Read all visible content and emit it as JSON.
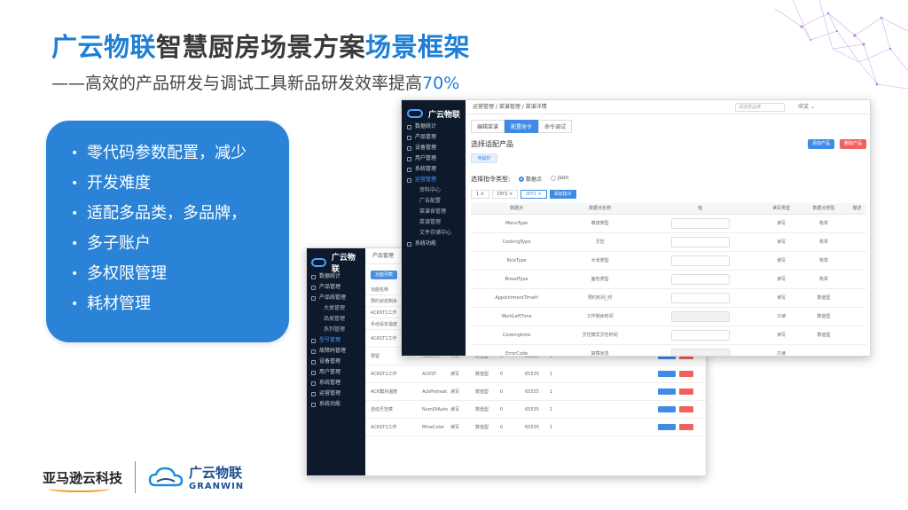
{
  "slide": {
    "title_part1": "广云物联",
    "title_part2": "智慧厨房场景方案",
    "title_part3": "场景框架",
    "subtitle_text": "——高效的产品研发与调试工具新品研发效率提高",
    "subtitle_highlight": "70%"
  },
  "features": {
    "items": [
      {
        "line1": "零代码参数配置，减少",
        "line2": "开发难度"
      },
      {
        "line1": "适配多品类，多品牌，",
        "line2": "多子账户"
      },
      {
        "line1": "多权限管理",
        "line2": ""
      },
      {
        "line1": "耗材管理",
        "line2": ""
      }
    ]
  },
  "back_app": {
    "logo": "广云物联",
    "topbar": "产品管理",
    "new_button": "功能列表",
    "sidebar": [
      {
        "label": "数据统计",
        "level": 0
      },
      {
        "label": "产品管理",
        "level": 0
      },
      {
        "label": "产品线管理",
        "level": 0
      },
      {
        "label": "大类管理",
        "level": 1
      },
      {
        "label": "品类管理",
        "level": 1
      },
      {
        "label": "系列管理",
        "level": 1
      },
      {
        "label": "型号管理",
        "level": 0,
        "active": true
      },
      {
        "label": "故障码管理",
        "level": 0
      },
      {
        "label": "设备管理",
        "level": 0
      },
      {
        "label": "用户管理",
        "level": 0
      },
      {
        "label": "系统管理",
        "level": 0
      },
      {
        "label": "运营管理",
        "level": 0
      },
      {
        "label": "系统功能",
        "level": 0
      }
    ],
    "rows": [
      {
        "c1": "功能名称",
        "c2": "",
        "c3": "",
        "c4": "",
        "c5": "",
        "c6": "",
        "c7": "",
        "buttons": false
      },
      {
        "c1": "预约状态剩余",
        "c2": "",
        "c3": "",
        "c4": "",
        "c5": "",
        "c6": "",
        "c7": "",
        "buttons": false
      },
      {
        "c1": "ACKST1工作",
        "c2": "",
        "c3": "",
        "c4": "",
        "c5": "",
        "c6": "",
        "c7": "",
        "buttons": false
      },
      {
        "c1": "手动设定温度",
        "c2": "",
        "c3": "",
        "c4": "",
        "c5": "",
        "c6": "",
        "c7": "",
        "buttons": false
      },
      {
        "c1": "ACKST1工作",
        "c2": "MineColor",
        "c3": "读写",
        "c4": "数值型",
        "c5": "0",
        "c6": "65535",
        "c7": "1",
        "buttons": true
      },
      {
        "c1": "预留",
        "c2": "Reserve",
        "c3": "只读",
        "c4": "数值型",
        "c5": "0",
        "c6": "65535",
        "c7": "1",
        "buttons": true
      },
      {
        "c1": "ACKST1工作",
        "c2": "ACKST",
        "c3": "读写",
        "c4": "数值型",
        "c5": "0",
        "c6": "65535",
        "c7": "1",
        "buttons": true
      },
      {
        "c1": "ACK模块温度",
        "c2": "AckPreheat",
        "c3": "读写",
        "c4": "数值型",
        "c5": "0",
        "c6": "65535",
        "c7": "1",
        "buttons": true
      },
      {
        "c1": "自动烹饪菜",
        "c2": "NumOfAuto",
        "c3": "读写",
        "c4": "数值型",
        "c5": "0",
        "c6": "65535",
        "c7": "1",
        "buttons": true
      },
      {
        "c1": "ACKST1工作",
        "c2": "MineColor",
        "c3": "读写",
        "c4": "数值型",
        "c5": "0",
        "c6": "65535",
        "c7": "1",
        "buttons": true
      }
    ]
  },
  "front_app": {
    "logo": "广云物联",
    "breadcrumb": "运营管理  /  菜谱管理  /  菜谱详情",
    "select_placeholder": "请选择品牌",
    "lang": "中文 ⌄",
    "sidebar": [
      {
        "label": "数据统计",
        "level": 0
      },
      {
        "label": "产品管理",
        "level": 0
      },
      {
        "label": "设备管理",
        "level": 0
      },
      {
        "label": "用户管理",
        "level": 0
      },
      {
        "label": "系统管理",
        "level": 0
      },
      {
        "label": "运营管理",
        "level": 0,
        "active": true
      },
      {
        "label": "资料中心",
        "level": 1
      },
      {
        "label": "广告配置",
        "level": 1
      },
      {
        "label": "菜谱食管理",
        "level": 1
      },
      {
        "label": "菜谱管理",
        "level": 1,
        "active": true
      },
      {
        "label": "文件存储中心",
        "level": 1
      },
      {
        "label": "系统功能",
        "level": 0
      }
    ],
    "tabs": [
      "编辑菜谱",
      "配置命令",
      "命令调试"
    ],
    "section_label": "选择适配产品",
    "chip": "电磁炉",
    "add_product": "添加产品",
    "del_product": "删除产品",
    "cmd_type_label": "选择指令类型:",
    "radio_option1": "数据点",
    "radio_option2": "json",
    "dtabs": [
      "1 ×",
      "DIY2 ×",
      "DIY1 ×"
    ],
    "dtab_add": "添加指令",
    "table_headers": [
      "数据点",
      "数据点名称",
      "值",
      "读写类型",
      "数据点类型",
      "描述"
    ],
    "table_rows": [
      {
        "dp": "MenuType",
        "name": "菜谱类型",
        "rw": "读写",
        "type": "枚举",
        "disabled": false
      },
      {
        "dp": "CookingType",
        "name": "烹饪",
        "rw": "读写",
        "type": "枚举",
        "disabled": false
      },
      {
        "dp": "RiceType",
        "name": "大米类型",
        "rw": "读写",
        "type": "枚举",
        "disabled": false
      },
      {
        "dp": "BreadType",
        "name": "面包类型",
        "rw": "读写",
        "type": "枚举",
        "disabled": false
      },
      {
        "dp": "AppointmentTimeH",
        "name": "预约时间_时",
        "rw": "读写",
        "type": "数值型",
        "disabled": false
      },
      {
        "dp": "WorkLeftTime",
        "name": "工作剩余时间",
        "rw": "只读",
        "type": "数值型",
        "disabled": true
      },
      {
        "dp": "Cookingtime",
        "name": "烹饪模式烹饪时间",
        "rw": "读写",
        "type": "数值型",
        "disabled": false
      },
      {
        "dp": "ErrorCode",
        "name": "故障状态",
        "rw": "只读",
        "type": "",
        "disabled": true
      }
    ]
  },
  "footer": {
    "amazon": "亚马逊云科技",
    "brand_cn": "广云物联",
    "brand_en": "GRANWIN"
  }
}
